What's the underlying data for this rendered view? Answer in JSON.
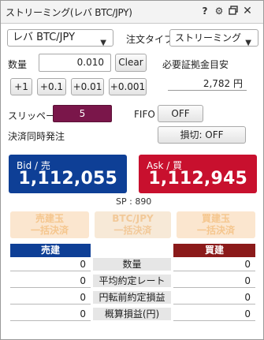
{
  "window": {
    "title": "ストリーミング(レバ BTC/JPY)",
    "icons": [
      "help-icon",
      "gear-icon",
      "restore-icon",
      "close-icon"
    ]
  },
  "order": {
    "symbol": "レバ BTC/JPY",
    "order_type_label": "注文タイプ",
    "order_type_value": "ストリーミング",
    "quantity_label": "数量",
    "quantity_value": "0.010",
    "clear_label": "Clear",
    "margin_label": "必要証拠金目安",
    "margin_value": "2,782 円",
    "increments": [
      "+1",
      "+0.1",
      "+0.01",
      "+0.001"
    ],
    "slippage_label": "スリッページ",
    "slippage_value": "5",
    "fifo_label": "FIFO",
    "fifo_value": "OFF",
    "simultaneous_label": "決済同時発注",
    "stoploss_value": "損切: OFF"
  },
  "quote": {
    "bid_label": "Bid / 売",
    "bid_price": "1,112,055",
    "ask_label": "Ask / 買",
    "ask_price": "1,112,945",
    "spread": "SP : 890",
    "bid_color": "#0e3f96",
    "ask_color": "#c8102e"
  },
  "batch": {
    "sell_line1": "売建玉",
    "sell_line2": "一括決済",
    "pair_line1": "BTC/JPY",
    "pair_line2": "一括決済",
    "buy_line1": "買建玉",
    "buy_line2": "一括決済"
  },
  "positions": {
    "sell_header": "売建",
    "buy_header": "買建",
    "rows": [
      {
        "label": "数量",
        "sell": "0",
        "buy": "0"
      },
      {
        "label": "平均約定レート",
        "sell": "0",
        "buy": "0"
      },
      {
        "label": "円転前約定損益",
        "sell": "0",
        "buy": "0"
      },
      {
        "label": "概算損益(円)",
        "sell": "0",
        "buy": "0"
      }
    ]
  }
}
